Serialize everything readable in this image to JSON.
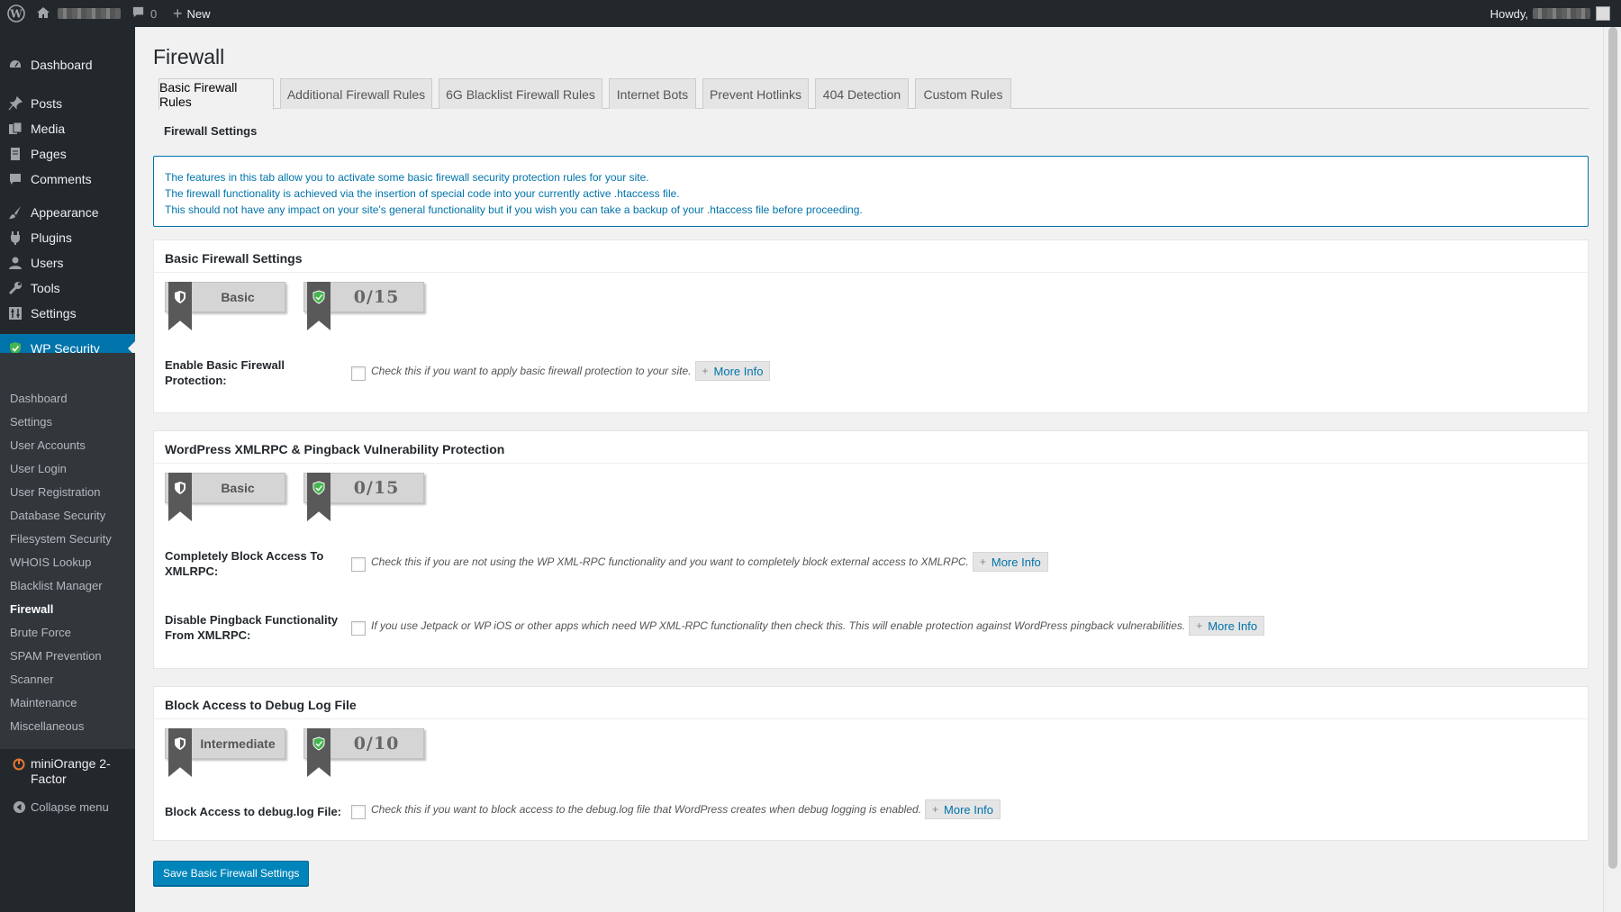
{
  "adminbar": {
    "comments_count": "0",
    "new_label": "New",
    "howdy_label": "Howdy,"
  },
  "sidebar": {
    "main_items": [
      {
        "label": "Dashboard",
        "icon": "dashboard-icon"
      },
      {
        "label": "Posts",
        "icon": "pushpin-icon"
      },
      {
        "label": "Media",
        "icon": "media-icon"
      },
      {
        "label": "Pages",
        "icon": "pages-icon"
      },
      {
        "label": "Comments",
        "icon": "comment-icon"
      },
      {
        "label": "Appearance",
        "icon": "paintbrush-icon"
      },
      {
        "label": "Plugins",
        "icon": "plugin-icon"
      },
      {
        "label": "Users",
        "icon": "user-icon"
      },
      {
        "label": "Tools",
        "icon": "wrench-icon"
      },
      {
        "label": "Settings",
        "icon": "settings-icon"
      },
      {
        "label": "WP Security",
        "icon": "shield-icon"
      }
    ],
    "submenu": [
      "Dashboard",
      "Settings",
      "User Accounts",
      "User Login",
      "User Registration",
      "Database Security",
      "Filesystem Security",
      "WHOIS Lookup",
      "Blacklist Manager",
      "Firewall",
      "Brute Force",
      "SPAM Prevention",
      "Scanner",
      "Maintenance",
      "Miscellaneous"
    ],
    "miniorange_line1": "miniOrange 2-",
    "miniorange_line2": "Factor",
    "collapse_label": "Collapse menu"
  },
  "page": {
    "title": "Firewall",
    "tabs": [
      "Basic Firewall Rules",
      "Additional Firewall Rules",
      "6G Blacklist Firewall Rules",
      "Internet Bots",
      "Prevent Hotlinks",
      "404 Detection",
      "Custom Rules"
    ],
    "active_tab": "Basic Firewall Rules",
    "section_heading": "Firewall Settings",
    "info_lines": [
      "The features in this tab allow you to activate some basic firewall security protection rules for your site.",
      "The firewall functionality is achieved via the insertion of special code into your currently active .htaccess file.",
      "This should not have any impact on your site's general functionality but if you wish you can take a backup of your .htaccess file before proceeding."
    ],
    "more_info_label": "More Info",
    "panels": [
      {
        "title": "Basic Firewall Settings",
        "level": "Basic",
        "score": "0/15",
        "fields": [
          {
            "label_l1": "Enable Basic Firewall",
            "label_l2": "Protection:",
            "desc": "Check this if you want to apply basic firewall protection to your site.",
            "checked": false
          }
        ]
      },
      {
        "title": "WordPress XMLRPC & Pingback Vulnerability Protection",
        "level": "Basic",
        "score": "0/15",
        "fields": [
          {
            "label_l1": "Completely Block Access To",
            "label_l2": "XMLRPC:",
            "desc": "Check this if you are not using the WP XML-RPC functionality and you want to completely block external access to XMLRPC.",
            "checked": false
          },
          {
            "label_l1": "Disable Pingback Functionality",
            "label_l2": "From XMLRPC:",
            "desc": "If you use Jetpack or WP iOS or other apps which need WP XML-RPC functionality then check this. This will enable protection against WordPress pingback vulnerabilities.",
            "checked": false
          }
        ]
      },
      {
        "title": "Block Access to Debug Log File",
        "level": "Intermediate",
        "score": "0/10",
        "fields": [
          {
            "label_l1": "Block Access to debug.log File:",
            "label_l2": "",
            "desc": "Check this if you want to block access to the debug.log file that WordPress creates when debug logging is enabled.",
            "checked": false
          }
        ]
      }
    ],
    "save_button": "Save Basic Firewall Settings"
  },
  "colors": {
    "accent": "#0073aa",
    "admin_bar": "#23282d",
    "submenu_bg": "#32373c",
    "badge_ribbon": "#595959",
    "shield_green": "#46b450"
  }
}
